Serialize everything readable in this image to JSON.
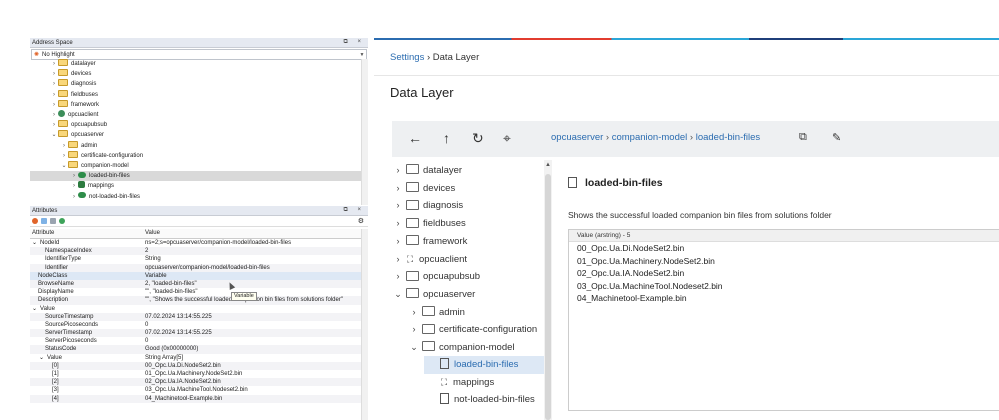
{
  "left_panel": {
    "address_space": {
      "title": "Address Space",
      "window_buttons": "⧉ ×",
      "highlight_select": "No Highlight",
      "tree": [
        {
          "label": "datalayer",
          "kind": "folder",
          "indent": 2,
          "chevron": "›"
        },
        {
          "label": "devices",
          "kind": "folder",
          "indent": 2,
          "chevron": "›"
        },
        {
          "label": "diagnosis",
          "kind": "folder",
          "indent": 2,
          "chevron": "›"
        },
        {
          "label": "fieldbuses",
          "kind": "folder",
          "indent": 2,
          "chevron": "›"
        },
        {
          "label": "framework",
          "kind": "folder",
          "indent": 2,
          "chevron": "›"
        },
        {
          "label": "opcuaclient",
          "kind": "object",
          "indent": 2,
          "chevron": "›"
        },
        {
          "label": "opcuapubsub",
          "kind": "folder",
          "indent": 2,
          "chevron": "›"
        },
        {
          "label": "opcuaserver",
          "kind": "folder",
          "indent": 2,
          "chevron": "⌄"
        },
        {
          "label": "admin",
          "kind": "folder",
          "indent": 3,
          "chevron": "›"
        },
        {
          "label": "certificate-configuration",
          "kind": "folder",
          "indent": 3,
          "chevron": "›"
        },
        {
          "label": "companion-model",
          "kind": "folder",
          "indent": 3,
          "chevron": "⌄"
        },
        {
          "label": "loaded-bin-files",
          "kind": "variable",
          "indent": 4,
          "chevron": "›",
          "selected": true
        },
        {
          "label": "mappings",
          "kind": "object-multi",
          "indent": 4,
          "chevron": "›"
        },
        {
          "label": "not-loaded-bin-files",
          "kind": "variable",
          "indent": 4,
          "chevron": "›"
        }
      ]
    },
    "attributes": {
      "title": "Attributes",
      "window_buttons": "⧉ ×",
      "header_attribute": "Attribute",
      "header_value": "Value",
      "rows": [
        {
          "attr": "NodeId",
          "value": "ns=2;s=opcuaserver/companion-model/loaded-bin-files",
          "level": 0,
          "chevron": "⌄"
        },
        {
          "attr": "NamespaceIndex",
          "value": "2",
          "level": 1
        },
        {
          "attr": "IdentifierType",
          "value": "String",
          "level": 1
        },
        {
          "attr": "Identifier",
          "value": "opcuaserver/companion-model/loaded-bin-files",
          "level": 1
        },
        {
          "attr": "NodeClass",
          "value": "Variable",
          "level": 0,
          "selected": true
        },
        {
          "attr": "BrowseName",
          "value": "2, \"loaded-bin-files\"",
          "level": 0
        },
        {
          "attr": "DisplayName",
          "value": "\"\", \"loaded-bin-files\"",
          "level": 0
        },
        {
          "attr": "Description",
          "value": "\"\", \"Shows the successful loaded companion bin files from solutions folder\"",
          "level": 0
        },
        {
          "attr": "Value",
          "value": "",
          "level": 0,
          "chevron": "⌄"
        },
        {
          "attr": "SourceTimestamp",
          "value": "07.02.2024 13:14:55.225",
          "level": 1
        },
        {
          "attr": "SourcePicoseconds",
          "value": "0",
          "level": 1
        },
        {
          "attr": "ServerTimestamp",
          "value": "07.02.2024 13:14:55.225",
          "level": 1
        },
        {
          "attr": "ServerPicoseconds",
          "value": "0",
          "level": 1
        },
        {
          "attr": "StatusCode",
          "value": "Good (0x00000000)",
          "level": 1
        },
        {
          "attr": "Value",
          "value": "String Array[5]",
          "level": 1,
          "chevron": "⌄"
        },
        {
          "attr": "[0]",
          "value": "00_Opc.Ua.Di.NodeSet2.bin",
          "level": 2
        },
        {
          "attr": "[1]",
          "value": "01_Opc.Ua.Machinery.NodeSet2.bin",
          "level": 2
        },
        {
          "attr": "[2]",
          "value": "02_Opc.Ua.IA.NodeSet2.bin",
          "level": 2
        },
        {
          "attr": "[3]",
          "value": "03_Opc.Ua.MachineTool.Nodeset2.bin",
          "level": 2
        },
        {
          "attr": "[4]",
          "value": "04_Machinetool-Example.bin",
          "level": 2
        }
      ],
      "tooltip": "Variable"
    }
  },
  "right_panel": {
    "breadcrumb": {
      "link": "Settings",
      "separator": "›",
      "current": "Data Layer"
    },
    "page_title": "Data Layer",
    "toolbar": {
      "icons": [
        "←",
        "↑",
        "↻",
        "⌖"
      ],
      "path": [
        {
          "label": "opcuaserver"
        },
        {
          "label": "companion-model"
        },
        {
          "label": "loaded-bin-files"
        }
      ],
      "path_separator": "›",
      "copy_icon": "⧉",
      "edit_icon": "✎"
    },
    "tree": [
      {
        "label": "datalayer",
        "chevron": "›",
        "indent": 0,
        "kind": "folder"
      },
      {
        "label": "devices",
        "chevron": "›",
        "indent": 0,
        "kind": "folder"
      },
      {
        "label": "diagnosis",
        "chevron": "›",
        "indent": 0,
        "kind": "folder"
      },
      {
        "label": "fieldbuses",
        "chevron": "›",
        "indent": 0,
        "kind": "folder"
      },
      {
        "label": "framework",
        "chevron": "›",
        "indent": 0,
        "kind": "folder"
      },
      {
        "label": "opcuaclient",
        "chevron": "›",
        "indent": 0,
        "kind": "network"
      },
      {
        "label": "opcuapubsub",
        "chevron": "›",
        "indent": 0,
        "kind": "folder"
      },
      {
        "label": "opcuaserver",
        "chevron": "⌄",
        "indent": 0,
        "kind": "folder"
      },
      {
        "label": "admin",
        "chevron": "›",
        "indent": 1,
        "kind": "folder"
      },
      {
        "label": "certificate-configuration",
        "chevron": "›",
        "indent": 1,
        "kind": "folder"
      },
      {
        "label": "companion-model",
        "chevron": "⌄",
        "indent": 1,
        "kind": "folder"
      },
      {
        "label": "loaded-bin-files",
        "chevron": "",
        "indent": 2,
        "kind": "doc",
        "selected": true
      },
      {
        "label": "mappings",
        "chevron": "",
        "indent": 2,
        "kind": "network"
      },
      {
        "label": "not-loaded-bin-files",
        "chevron": "",
        "indent": 2,
        "kind": "doc"
      }
    ],
    "detail": {
      "title": "loaded-bin-files",
      "description": "Shows the successful loaded companion bin files from solutions folder",
      "value_header": "Value (arstring) - 5",
      "values": [
        "00_Opc.Ua.Di.NodeSet2.bin",
        "01_Opc.Ua.Machinery.NodeSet2.bin",
        "02_Opc.Ua.IA.NodeSet2.bin",
        "03_Opc.Ua.MachineTool.Nodeset2.bin",
        "04_Machinetool-Example.bin"
      ]
    },
    "accent_colors": [
      "#2b6cb0",
      "#e23c2f",
      "#2aa6d8"
    ]
  }
}
